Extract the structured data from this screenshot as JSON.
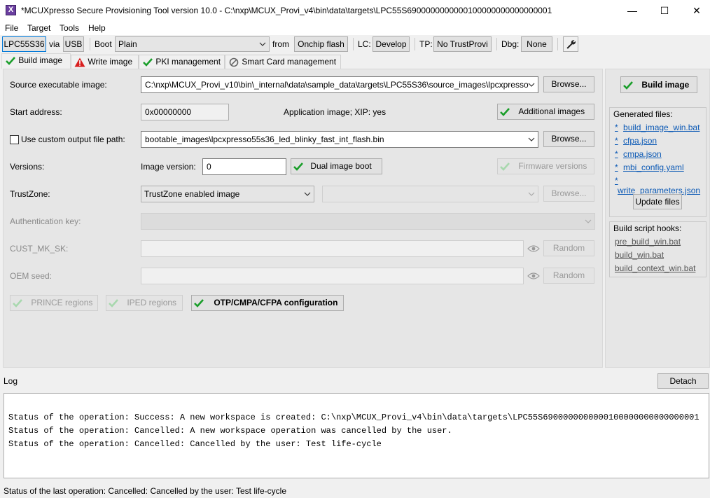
{
  "window": {
    "title": "*MCUXpresso Secure Provisioning Tool version 10.0 - C:\\nxp\\MCUX_Provi_v4\\bin\\data\\targets\\LPC55S6900000000000100000000000000001",
    "minimize": "—",
    "maximize": "☐",
    "close": "✕"
  },
  "menu": {
    "file": "File",
    "target": "Target",
    "tools": "Tools",
    "help": "Help"
  },
  "toolbar": {
    "device": "LPC55S36",
    "via_label": "via",
    "connection": "USB",
    "boot_label": "Boot",
    "boot_value": "Plain",
    "from_label": "from",
    "boot_memory": "Onchip flash",
    "lc_label": "LC:",
    "lc_value": "Develop",
    "tp_label": "TP:",
    "tp_value": "No TrustProvi",
    "dbg_label": "Dbg:",
    "dbg_value": "None",
    "tool_icon": "wrench-icon"
  },
  "tabs": [
    {
      "label": "Build image",
      "icon": "check-icon"
    },
    {
      "label": "Write image",
      "icon": "warning-icon"
    },
    {
      "label": "PKI management",
      "icon": "check-icon"
    },
    {
      "label": "Smart Card management",
      "icon": "disabled-icon"
    }
  ],
  "build": {
    "source_label": "Source executable image:",
    "source_value": "C:\\nxp\\MCUX_Provi_v10\\bin\\_internal\\data\\sample_data\\targets\\LPC55S36\\source_images\\lpcxpresso",
    "browse": "Browse...",
    "start_label": "Start address:",
    "start_value": "0x00000000",
    "app_info": "Application image; XIP: yes",
    "additional_images": "Additional images",
    "custom_output_label": "Use custom output file path:",
    "output_value": "bootable_images\\lpcxpresso55s36_led_blinky_fast_int_flash.bin",
    "versions_label": "Versions:",
    "image_version_label": "Image version:",
    "image_version_value": "0",
    "dual_image_boot": "Dual image boot",
    "firmware_versions": "Firmware versions",
    "trustzone_label": "TrustZone:",
    "trustzone_value": "TrustZone enabled image",
    "auth_key_label": "Authentication key:",
    "cust_mk_label": "CUST_MK_SK:",
    "random": "Random",
    "oem_seed_label": "OEM seed:",
    "prince": "PRINCE regions",
    "iped": "IPED regions",
    "otp": "OTP/CMPA/CFPA configuration"
  },
  "right": {
    "build_image": "Build image",
    "generated_title": "Generated files:",
    "generated_files": [
      "build_image_win.bat",
      "cfpa.json",
      "cmpa.json",
      "mbi_config.yaml",
      "write_parameters.json"
    ],
    "modified_marker": "*",
    "update_files": "Update files",
    "hooks_title": "Build script hooks:",
    "hooks": [
      "pre_build_win.bat",
      "build_win.bat",
      "build_context_win.bat"
    ]
  },
  "log": {
    "label": "Log",
    "detach": "Detach",
    "lines": [
      "Status of the operation: Success: A new workspace is created: C:\\nxp\\MCUX_Provi_v4\\bin\\data\\targets\\LPC55S6900000000000100000000000000001",
      "Status of the operation: Cancelled: A new workspace operation was cancelled by the user.",
      "Status of the operation: Cancelled: Cancelled by the user: Test life-cycle"
    ]
  },
  "status": {
    "text": "Status of the last operation: Cancelled: Cancelled by the user: Test life-cycle"
  },
  "colors": {
    "check_green": "#1a9e2a",
    "warning_red": "#d81e1e",
    "link_blue": "#0b59b5"
  }
}
